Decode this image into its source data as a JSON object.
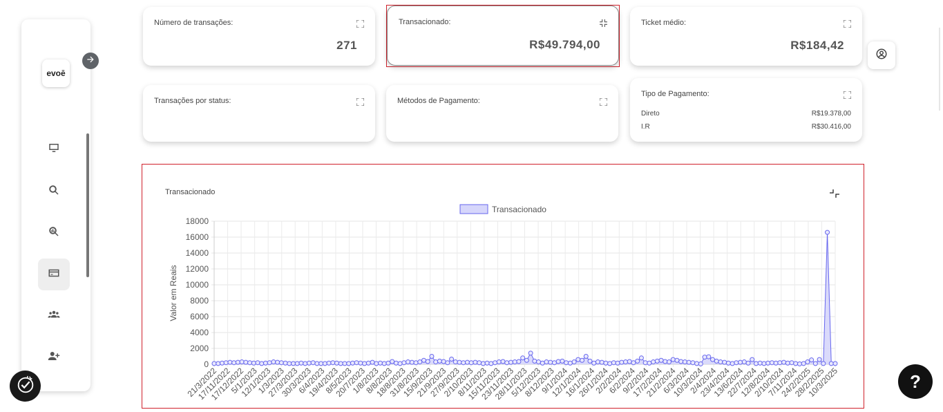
{
  "sidebar": {
    "logo_text": "evoē",
    "items": [
      {
        "icon": "monitor-icon"
      },
      {
        "icon": "search-icon"
      },
      {
        "icon": "analytics-search-icon"
      },
      {
        "icon": "credit-card-icon",
        "active": true
      },
      {
        "icon": "group-icon"
      },
      {
        "icon": "add-user-icon"
      }
    ]
  },
  "cards": {
    "transactions_count": {
      "title": "Número de transações:",
      "value": "271"
    },
    "transacted": {
      "title": "Transacionado:",
      "value": "R$49.794,00"
    },
    "avg_ticket": {
      "title": "Ticket médio:",
      "value": "R$184,42"
    },
    "status": {
      "title": "Transações por status:"
    },
    "payment_methods": {
      "title": "Métodos de Pagamento:"
    },
    "payment_type": {
      "title": "Tipo de Pagamento:",
      "rows": [
        {
          "label": "Direto",
          "value": "R$19.378,00"
        },
        {
          "label": "I.R",
          "value": "R$30.416,00"
        }
      ]
    }
  },
  "help": {
    "label": "?"
  },
  "colors": {
    "accent": "#6666ee",
    "fill": "#d6d6fb",
    "highlight": "#d0202a"
  },
  "chart_data": {
    "type": "area",
    "panel_title": "Transacionado",
    "legend": [
      "Transacionado"
    ],
    "ylabel": "Valor em Reais",
    "ylim": [
      0,
      18000
    ],
    "yticks": [
      0,
      2000,
      4000,
      6000,
      8000,
      10000,
      12000,
      14000,
      16000,
      18000
    ],
    "x_tick_labels": [
      "21/3/2022",
      "17/11/2022",
      "17/12/2022",
      "5/1/2023",
      "12/1/2023",
      "1/3/2023",
      "27/3/2023",
      "30/3/2023",
      "6/4/2023",
      "19/4/2023",
      "8/5/2023",
      "20/7/2023",
      "1/8/2023",
      "8/8/2023",
      "18/8/2023",
      "31/8/2023",
      "15/9/2023",
      "21/9/2023",
      "27/9/2023",
      "2/10/2023",
      "8/11/2023",
      "15/11/2023",
      "23/11/2023",
      "28/11/2023",
      "5/12/2023",
      "8/12/2023",
      "9/1/2024",
      "12/1/2024",
      "16/1/2024",
      "26/1/2024",
      "2/2/2024",
      "6/2/2024",
      "9/2/2024",
      "17/2/2024",
      "21/2/2024",
      "6/3/2024",
      "10/3/2024",
      "2/4/2024",
      "23/4/2024",
      "13/6/2024",
      "22/7/2024",
      "12/8/2024",
      "2/10/2024",
      "7/11/2024",
      "24/2/2025",
      "28/2/2025",
      "10/3/2025"
    ],
    "series": [
      {
        "name": "Transacionado",
        "values": [
          100,
          100,
          150,
          200,
          250,
          200,
          250,
          300,
          250,
          200,
          150,
          200,
          100,
          150,
          200,
          300,
          250,
          200,
          150,
          100,
          100,
          100,
          150,
          100,
          150,
          200,
          100,
          100,
          100,
          150,
          200,
          150,
          100,
          100,
          100,
          150,
          200,
          150,
          100,
          150,
          250,
          100,
          150,
          100,
          150,
          350,
          150,
          100,
          200,
          300,
          250,
          200,
          300,
          500,
          350,
          1000,
          300,
          400,
          350,
          200,
          650,
          300,
          250,
          200,
          250,
          200,
          250,
          200,
          100,
          150,
          100,
          200,
          300,
          350,
          200,
          250,
          300,
          350,
          800,
          500,
          1400,
          400,
          300,
          150,
          300,
          250,
          200,
          350,
          400,
          200,
          150,
          300,
          600,
          500,
          1000,
          400,
          150,
          300,
          250,
          150,
          100,
          200,
          150,
          250,
          300,
          350,
          200,
          400,
          800,
          200,
          150,
          300,
          400,
          500,
          350,
          300,
          600,
          500,
          350,
          300,
          250,
          200,
          100,
          50,
          900,
          950,
          600,
          400,
          300,
          250,
          150,
          100,
          200,
          250,
          300,
          150,
          600,
          100,
          150,
          100,
          150,
          200,
          150,
          200,
          250,
          150,
          200,
          100,
          50,
          100,
          300,
          550,
          100,
          600,
          100,
          16600,
          100,
          100
        ]
      }
    ]
  }
}
